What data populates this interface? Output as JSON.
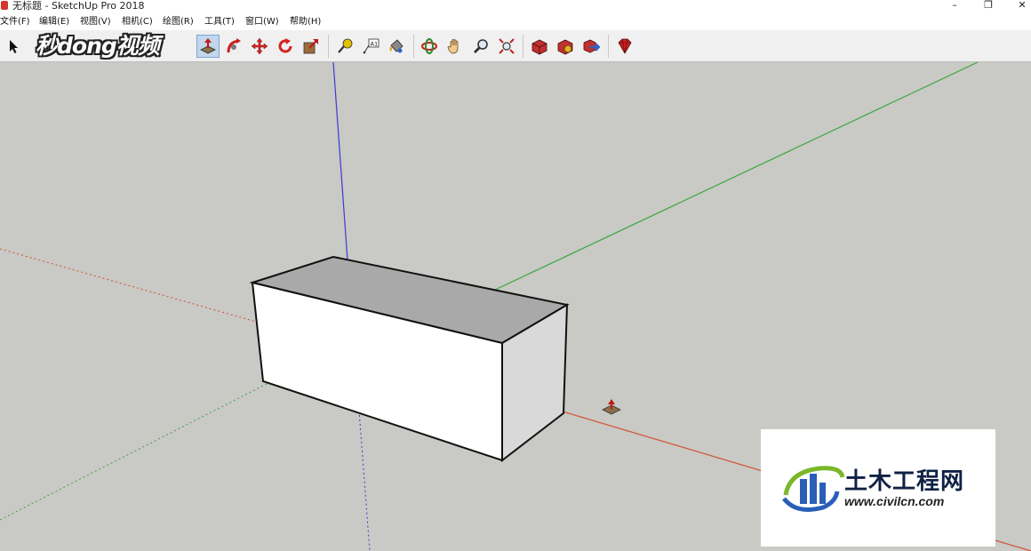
{
  "window": {
    "title": "无标题 - SketchUp Pro 2018",
    "minimize_glyph": "–",
    "restore_glyph": "❐",
    "close_glyph": "✕"
  },
  "menu": [
    {
      "label": "文件(F)"
    },
    {
      "label": "编辑(E)"
    },
    {
      "label": "视图(V)"
    },
    {
      "label": "相机(C)"
    },
    {
      "label": "绘图(R)"
    },
    {
      "label": "工具(T)"
    },
    {
      "label": "窗口(W)"
    },
    {
      "label": "帮助(H)"
    }
  ],
  "toolbar": {
    "tools": [
      {
        "name": "select-tool-icon",
        "active": false
      },
      {
        "name": "push-pull-tool-icon",
        "active": true
      },
      {
        "name": "follow-me-tool-icon",
        "active": false
      },
      {
        "name": "move-tool-icon",
        "active": false
      },
      {
        "name": "rotate-tool-icon",
        "active": false
      },
      {
        "name": "scale-tool-icon",
        "active": false
      },
      {
        "name": "tape-measure-tool-icon",
        "active": false
      },
      {
        "name": "text-tool-icon",
        "active": false
      },
      {
        "name": "paint-bucket-tool-icon",
        "active": false
      },
      {
        "name": "orbit-tool-icon",
        "active": false
      },
      {
        "name": "pan-tool-icon",
        "active": false
      },
      {
        "name": "zoom-tool-icon",
        "active": false
      },
      {
        "name": "zoom-extents-tool-icon",
        "active": false
      },
      {
        "name": "warehouse-icon",
        "active": false
      },
      {
        "name": "extension-warehouse-icon",
        "active": false
      },
      {
        "name": "share-model-icon",
        "active": false
      },
      {
        "name": "extension-manager-icon",
        "active": false
      }
    ]
  },
  "watermarks": {
    "top_left": "秒dong视频",
    "bottom_right_cn": "土木工程网",
    "bottom_right_url": "www.civilcn.com"
  },
  "colors": {
    "canvas": "#c9c9c5",
    "red_axis": "#d4512f",
    "green_axis": "#39a83a",
    "blue_axis": "#3b3bd6",
    "box_top": "#a9a9a9",
    "box_front": "#ffffff",
    "box_side": "#d9d9d9"
  }
}
